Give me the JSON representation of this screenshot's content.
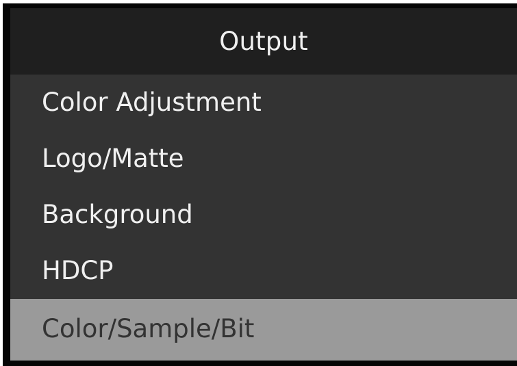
{
  "menu": {
    "title": "Output",
    "items": [
      {
        "label": "Color Adjustment",
        "selected": false
      },
      {
        "label": "Logo/Matte",
        "selected": false
      },
      {
        "label": "Background",
        "selected": false
      },
      {
        "label": "HDCP",
        "selected": false
      },
      {
        "label": "Color/Sample/Bit",
        "selected": true
      }
    ]
  },
  "colors": {
    "frame": "#050505",
    "header_bg": "#1f1f1f",
    "list_bg": "#333333",
    "selected_bg": "#9a9a9a",
    "text": "#f0f0f0",
    "selected_text": "#333333"
  }
}
